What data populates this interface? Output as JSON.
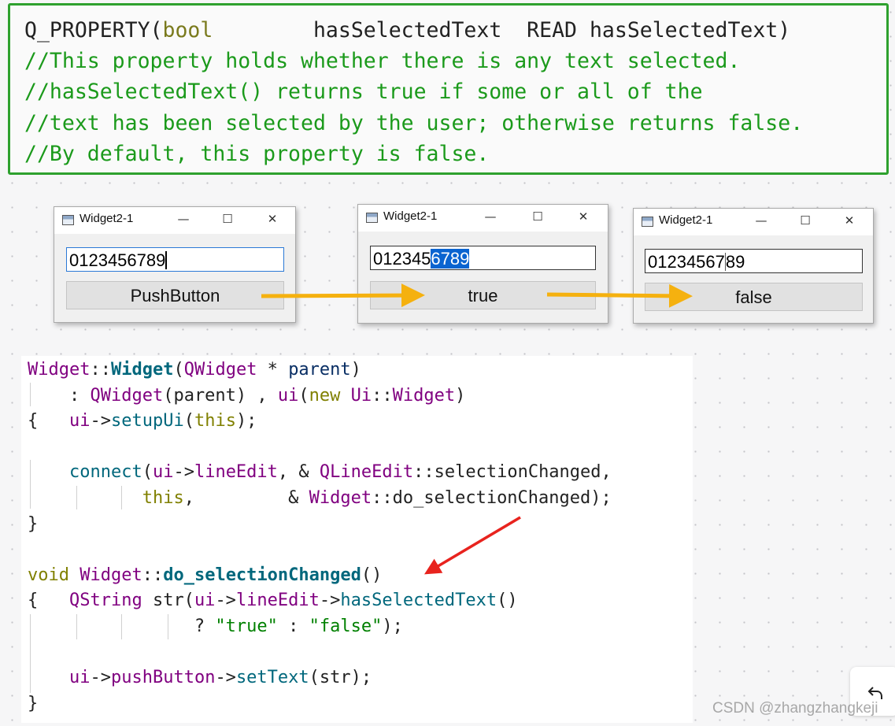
{
  "doc_block": {
    "line1": {
      "macro": "Q_PROPERTY(",
      "type": "bool",
      "spacer": "        hasSelectedText  READ hasSelectedText)"
    },
    "comments": [
      "//This property holds whether there is any text selected.",
      "//hasSelectedText() returns true if some or all of the",
      "//text has been selected by the user; otherwise returns false.",
      "//By default, this property is false."
    ]
  },
  "windows": [
    {
      "title": "Widget2-1",
      "minimize": "—",
      "maximize": "☐",
      "close": "✕",
      "line_edit": {
        "before": "0123456789",
        "selected": "",
        "after": ""
      },
      "button_label": "PushButton"
    },
    {
      "title": "Widget2-1",
      "minimize": "—",
      "maximize": "☐",
      "close": "✕",
      "line_edit": {
        "before": "012345",
        "selected": "6789",
        "after": ""
      },
      "button_label": "true"
    },
    {
      "title": "Widget2-1",
      "minimize": "—",
      "maximize": "☐",
      "close": "✕",
      "line_edit": {
        "before": "01234567",
        "selected": "",
        "after": "89"
      },
      "button_label": "false"
    }
  ],
  "code": {
    "l1": {
      "a": "Widget",
      "b": "::",
      "c": "Widget",
      "d": "(",
      "e": "QWidget",
      "f": " * ",
      "g": "parent",
      "h": ")"
    },
    "l2": {
      "a": "    : ",
      "b": "QWidget",
      "c": "(parent) , ",
      "d": "ui",
      "e": "(",
      "f": "new",
      "g": " ",
      "h": "Ui",
      "i": "::",
      "j": "Widget",
      "k": ")"
    },
    "l3": {
      "a": "{   ",
      "b": "ui",
      "c": "->",
      "d": "setupUi",
      "e": "(",
      "f": "this",
      "g": ");"
    },
    "l5": {
      "a": "    ",
      "b": "connect",
      "c": "(",
      "d": "ui",
      "e": "->",
      "f": "lineEdit",
      "g": ", & ",
      "h": "QLineEdit",
      "i": "::selectionChanged,",
      "j": "           ",
      "k": "this",
      "l": ",         & ",
      "m": "Widget",
      "n": "::do_selectionChanged);"
    },
    "l7": "}",
    "l9": {
      "a": "void",
      "b": " ",
      "c": "Widget",
      "d": "::",
      "e": "do_selectionChanged",
      "f": "()"
    },
    "l10": {
      "a": "{   ",
      "b": "QString",
      "c": " str(",
      "d": "ui",
      "e": "->",
      "f": "lineEdit",
      "g": "->",
      "h": "hasSelectedText",
      "i": "()"
    },
    "l11": {
      "a": "                ? ",
      "b": "\"true\"",
      "c": " : ",
      "d": "\"false\"",
      "e": ");"
    },
    "l13": {
      "a": "    ",
      "b": "ui",
      "c": "->",
      "d": "pushButton",
      "e": "->",
      "f": "setText",
      "g": "(str);"
    },
    "l14": "}"
  },
  "watermark": "CSDN @zhangzhangkeji",
  "undo_icon": "undo-icon",
  "colors": {
    "border_green": "#2ea12e",
    "comment_green": "#1b9a1b",
    "arrow_orange": "#f5b10f",
    "arrow_red": "#e8231e",
    "selection_blue": "#0a64d0"
  }
}
